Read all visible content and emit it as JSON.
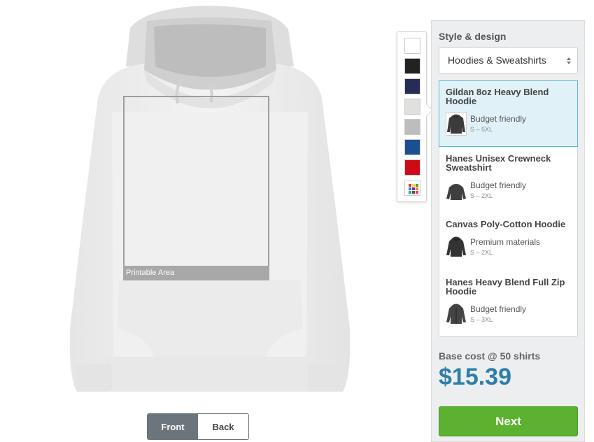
{
  "preview": {
    "printable_area_label": "Printable Area",
    "view_toggle": {
      "front_label": "Front",
      "back_label": "Back",
      "active": "Front"
    }
  },
  "colors": [
    {
      "name": "white",
      "hex": "#ffffff"
    },
    {
      "name": "black",
      "hex": "#222222"
    },
    {
      "name": "navy",
      "hex": "#262c55"
    },
    {
      "name": "light-grey",
      "hex": "#e2e0de"
    },
    {
      "name": "grey",
      "hex": "#bdbdbd"
    },
    {
      "name": "royal-blue",
      "hex": "#1a4f92"
    },
    {
      "name": "red",
      "hex": "#cc0b17"
    },
    {
      "name": "more-colors",
      "hex": "multicolor"
    }
  ],
  "sidebar": {
    "title": "Style & design",
    "style_select": {
      "value": "Hoodies & Sweatshirts"
    },
    "products": [
      {
        "name": "Gildan 8oz Heavy Blend Hoodie",
        "tag": "Budget friendly",
        "sizes": "S – 5XL",
        "selected": true
      },
      {
        "name": "Hanes Unisex Crewneck Sweatshirt",
        "tag": "Budget friendly",
        "sizes": "S – 2XL",
        "selected": false
      },
      {
        "name": "Canvas Poly-Cotton Hoodie",
        "tag": "Premium materials",
        "sizes": "S – 2XL",
        "selected": false
      },
      {
        "name": "Hanes Heavy Blend Full Zip Hoodie",
        "tag": "Budget friendly",
        "sizes": "S – 3XL",
        "selected": false
      }
    ],
    "cost_label": "Base cost @ 50 shirts",
    "cost_value": "$15.39",
    "next_label": "Next"
  },
  "accent_colors": {
    "price": "#2e7fa9",
    "next_button": "#5cb130",
    "selected_product": "#e0f2f8"
  }
}
